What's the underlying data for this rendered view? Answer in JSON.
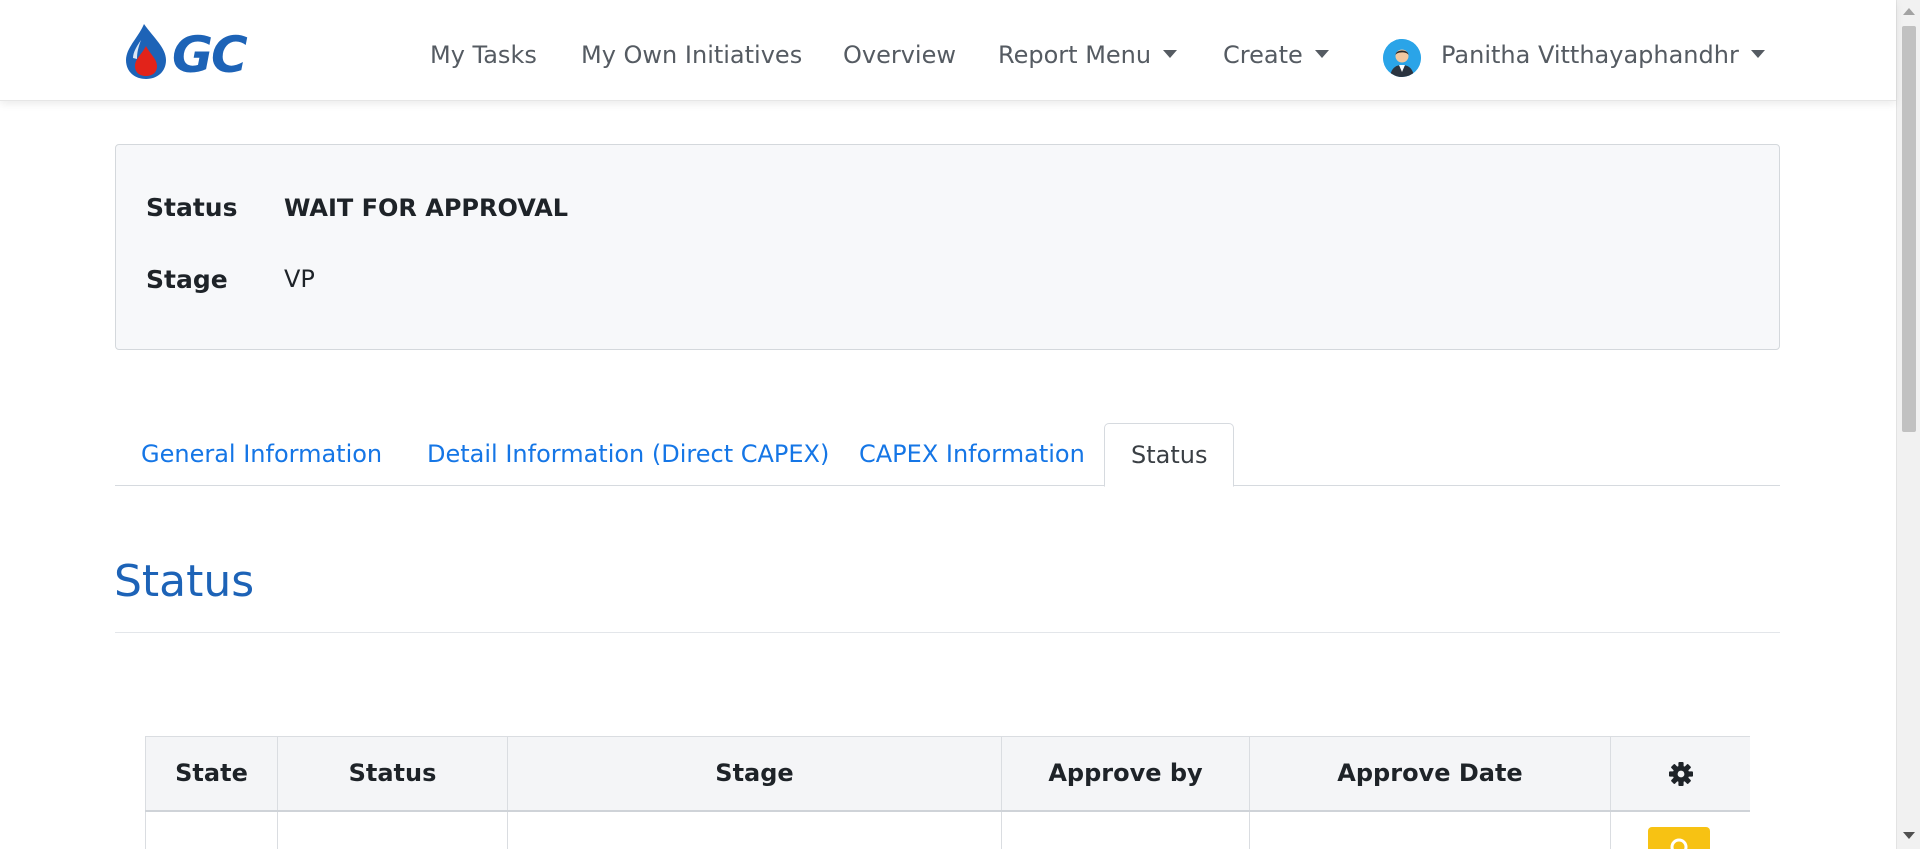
{
  "navbar": {
    "logo_text": "GC",
    "items": [
      {
        "label": "My Tasks"
      },
      {
        "label": "My Own Initiatives"
      },
      {
        "label": "Overview"
      },
      {
        "label": "Report Menu"
      },
      {
        "label": "Create"
      }
    ],
    "user": {
      "name": "Panitha Vitthayaphandhr"
    }
  },
  "summary": {
    "status_label": "Status",
    "status_value": "WAIT FOR APPROVAL",
    "stage_label": "Stage",
    "stage_value": "VP"
  },
  "tabs": [
    {
      "label": "General Information",
      "active": false
    },
    {
      "label": "Detail Information (Direct CAPEX)",
      "active": false
    },
    {
      "label": "CAPEX Information",
      "active": false
    },
    {
      "label": "Status",
      "active": true
    }
  ],
  "section": {
    "title": "Status"
  },
  "table": {
    "columns": [
      "State",
      "Status",
      "Stage",
      "Approve by",
      "Approve Date"
    ],
    "settings_icon": "gear-icon"
  },
  "icons": {
    "caret": "caret-down-icon",
    "edit": "edit-icon"
  },
  "colors": {
    "brand_blue": "#1d63b7",
    "link_blue": "#1576e6",
    "action_yellow": "#f7c213",
    "logo_red": "#e2231a"
  }
}
